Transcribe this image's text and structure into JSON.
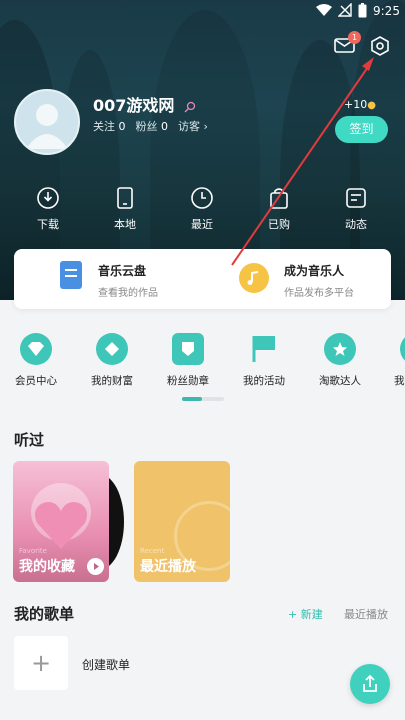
{
  "status_bar": {
    "time": "9:25"
  },
  "header": {
    "mail_badge": "1"
  },
  "profile": {
    "name": "007游戏网",
    "follow_label": "关注",
    "follow_count": "0",
    "fans_label": "粉丝",
    "fans_count": "0",
    "visitors_label": "访客",
    "points_bonus": "+10",
    "signin_label": "签到"
  },
  "quick_actions": [
    {
      "label": "下载",
      "icon": "download-icon"
    },
    {
      "label": "本地",
      "icon": "phone-icon"
    },
    {
      "label": "最近",
      "icon": "clock-icon"
    },
    {
      "label": "已购",
      "icon": "bag-icon"
    },
    {
      "label": "动态",
      "icon": "feed-icon"
    }
  ],
  "cards": {
    "cloud": {
      "title": "音乐云盘",
      "subtitle": "查看我的作品"
    },
    "musician": {
      "title": "成为音乐人",
      "subtitle": "作品发布多平台"
    }
  },
  "features": [
    {
      "label": "会员中心",
      "icon": "diamond-icon"
    },
    {
      "label": "我的财富",
      "icon": "wealth-icon"
    },
    {
      "label": "粉丝勋章",
      "icon": "badge-icon"
    },
    {
      "label": "我的活动",
      "icon": "flag-icon"
    },
    {
      "label": "淘歌达人",
      "icon": "star-icon"
    },
    {
      "label": "我",
      "icon": "more-icon"
    }
  ],
  "heard": {
    "title": "听过",
    "favorites": {
      "small": "Favorite",
      "label": "我的收藏"
    },
    "recent": {
      "small": "Recent",
      "label": "最近播放"
    }
  },
  "playlists": {
    "title": "我的歌单",
    "new_label": "+ 新建",
    "recent_label": "最近播放",
    "create_label": "创建歌单"
  },
  "colors": {
    "accent": "#3fd9c4",
    "hero": "#1d4450",
    "arrow": "#e23b3b"
  }
}
